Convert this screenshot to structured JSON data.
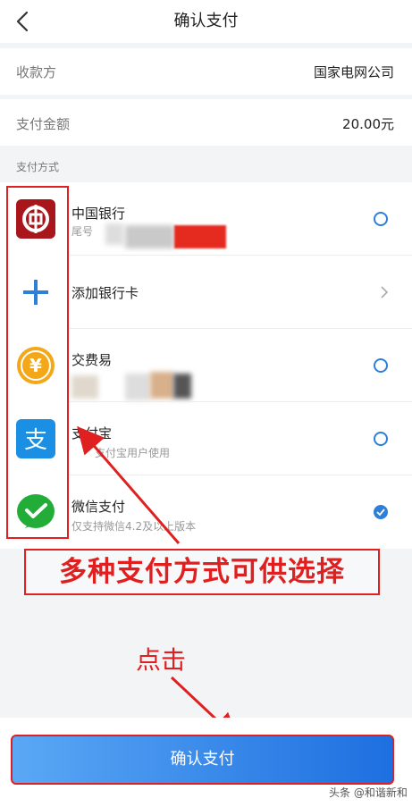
{
  "header": {
    "title": "确认支付"
  },
  "payee": {
    "label": "收款方",
    "value": "国家电网公司"
  },
  "amount": {
    "label": "支付金额",
    "value": "20.00元"
  },
  "section_label": "支付方式",
  "methods": [
    {
      "name": "中国银行",
      "sub": "尾号",
      "icon": "boc-icon",
      "control": "radio"
    },
    {
      "name": "添加银行卡",
      "sub": "",
      "icon": "plus-icon",
      "control": "chevron"
    },
    {
      "name": "交费易",
      "sub": "",
      "icon": "yuan-coin-icon",
      "control": "radio"
    },
    {
      "name": "支付宝",
      "sub": "支付宝用户使用",
      "icon": "alipay-icon",
      "control": "radio"
    },
    {
      "name": "微信支付",
      "sub": "仅支持微信4.2及以上版本",
      "icon": "wechat-pay-icon",
      "control": "radio-checked"
    }
  ],
  "annotations": {
    "banner": "多种支付方式可供选择",
    "click": "点击"
  },
  "pay_button": "确认支付",
  "watermark": "头条 @和谐新和",
  "colors": {
    "accent": "#2d7fd8",
    "annotation_red": "#e02020"
  }
}
